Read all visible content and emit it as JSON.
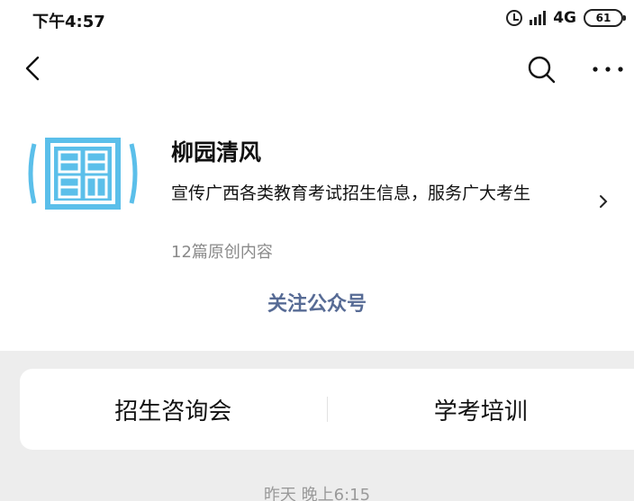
{
  "status_bar": {
    "time": "下午4:57",
    "network": "4G",
    "battery": "61",
    "icons": [
      "alarm-icon",
      "signal-icon",
      "battery-icon"
    ]
  },
  "nav": {
    "icons": [
      "back-icon",
      "search-icon",
      "more-icon"
    ]
  },
  "account": {
    "name": "柳园清风",
    "description": "宣传广西各类教育考试招生信息，服务广大考生",
    "article_count": "12篇原创内容",
    "logo": "gee-logo-icon"
  },
  "follow_label": "关注公众号",
  "menu": {
    "items": [
      "招生咨询会",
      "学考培训"
    ]
  },
  "feed": {
    "date": "昨天 晚上6:15"
  },
  "colors": {
    "link_blue": "#576b95",
    "logo_blue": "#5bbfea",
    "background_gray": "#ededed"
  }
}
